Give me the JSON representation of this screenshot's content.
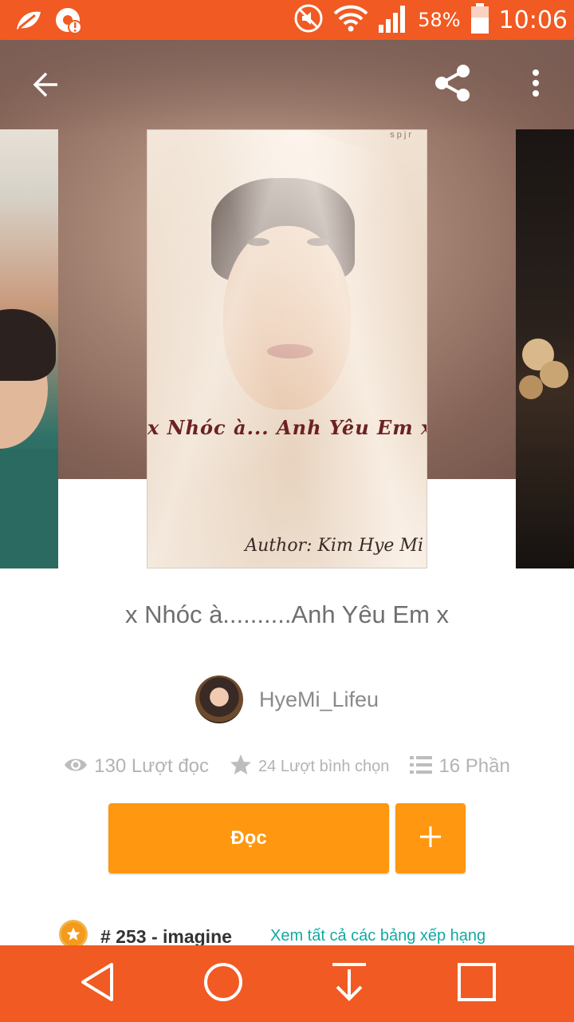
{
  "status_bar": {
    "time": "10:06",
    "battery_percent": "58%",
    "icons": [
      "leaf-app-icon",
      "notification-alert-icon",
      "mute-icon",
      "wifi-icon",
      "signal-icon",
      "battery-icon"
    ]
  },
  "toolbar": {
    "icons": [
      "back-arrow-icon",
      "share-icon",
      "more-vert-icon"
    ]
  },
  "cover": {
    "title": "x Nhóc à... Anh Yêu Em x",
    "author": "Author: Kim Hye Mi",
    "mark": "spjr"
  },
  "story": {
    "title": "x Nhóc à..........Anh Yêu Em x",
    "author_name": "HyeMi_Lifeu",
    "stats": {
      "reads": "130 Lượt đọc",
      "votes": "24 Lượt bình chọn",
      "parts": "16 Phần"
    }
  },
  "actions": {
    "read_label": "Đọc",
    "add_icon": "plus-icon"
  },
  "ranking": {
    "text": "# 253 - imagine",
    "link": "Xem tất cả các bảng xếp hạng"
  },
  "nav_bar": {
    "icons": [
      "back-triangle-icon",
      "home-circle-icon",
      "download-icon",
      "recents-square-icon"
    ]
  },
  "colors": {
    "accent": "#f15a22",
    "button": "#ff9710",
    "link": "#12a9a3"
  }
}
